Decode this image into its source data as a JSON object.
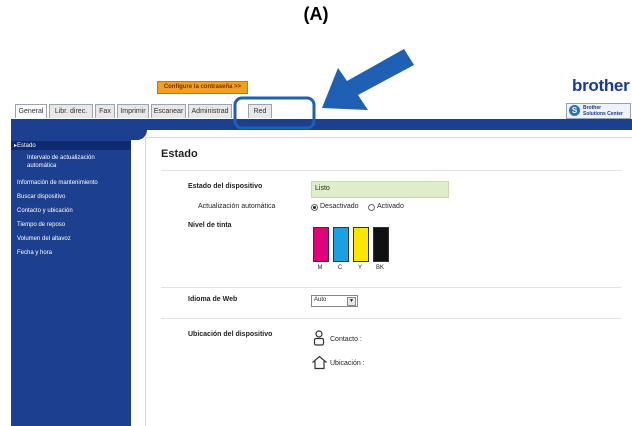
{
  "caption": "(A)",
  "header": {
    "password_button": "Configure la contraseña >>",
    "logo": "brother",
    "solutions_center_line1": "Brother",
    "solutions_center_line2": "Solutions Center"
  },
  "tabs": [
    {
      "label": "General"
    },
    {
      "label": "Libr. direc."
    },
    {
      "label": "Fax"
    },
    {
      "label": "Imprimir"
    },
    {
      "label": "Escanear"
    },
    {
      "label": "Administrad"
    },
    {
      "label": "Red"
    }
  ],
  "sidebar": {
    "items": [
      {
        "label": "▸Estado"
      },
      {
        "label": "Intervalo de actualización"
      },
      {
        "label": "automática"
      },
      {
        "label": "Información de mantenimiento"
      },
      {
        "label": "Buscar dispositivo"
      },
      {
        "label": "Contacto y ubicación"
      },
      {
        "label": "Tiempo de reposo"
      },
      {
        "label": "Volumen del altavoz"
      },
      {
        "label": "Fecha y hora"
      }
    ]
  },
  "main": {
    "title": "Estado",
    "device_status_label": "Estado del dispositivo",
    "device_status_value": "Listo",
    "auto_refresh_label": "Actualización automática",
    "auto_refresh_off": "Desactivado",
    "auto_refresh_on": "Activado",
    "ink_label": "Nivel de tinta",
    "inks": [
      {
        "label": "M",
        "color": "#e0007a"
      },
      {
        "label": "C",
        "color": "#1ba1e2"
      },
      {
        "label": "Y",
        "color": "#ffe600"
      },
      {
        "label": "BK",
        "color": "#111111"
      }
    ],
    "web_language_label": "Idioma de Web",
    "web_language_value": "Auto",
    "location_label": "Ubicación del dispositivo",
    "contact_label": "Contacto :",
    "location_value_label": "Ubicación :"
  },
  "colors": {
    "nav_blue": "#1c3f8f",
    "arrow_blue": "#1f5fb4",
    "highlight": "#1f5fb4",
    "button_orange": "#f0a020"
  }
}
